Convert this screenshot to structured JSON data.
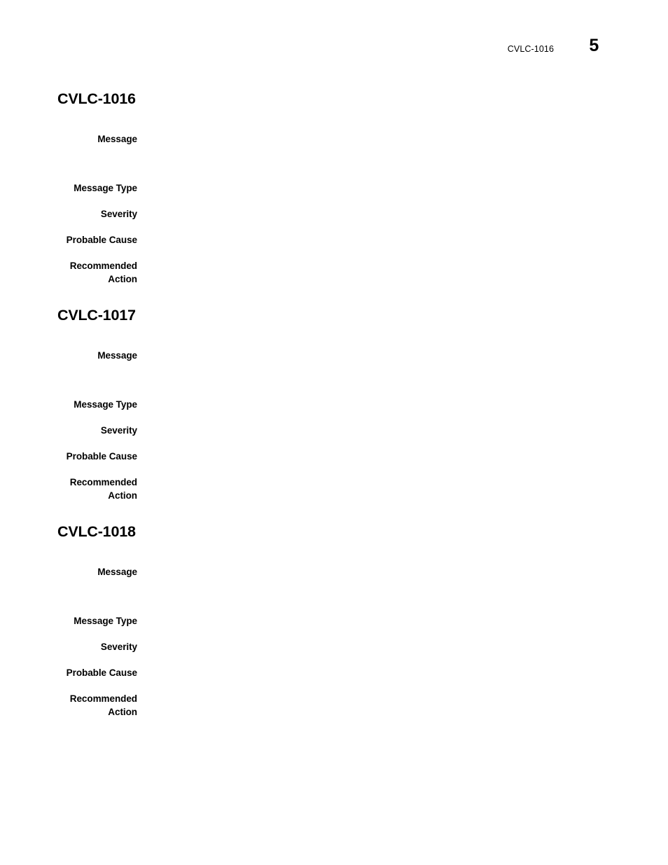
{
  "page": {
    "running_head": "CVLC-1016",
    "page_number": "5",
    "background_color": "#ffffff",
    "text_color": "#000000"
  },
  "labels": {
    "message": "Message",
    "message_type": "Message Type",
    "severity": "Severity",
    "probable_cause": "Probable Cause",
    "recommended_action": "Recommended\nAction"
  },
  "sections": [
    {
      "heading": "CVLC-1016",
      "message": "",
      "message_type": "",
      "severity": "",
      "probable_cause": "",
      "recommended_action": ""
    },
    {
      "heading": "CVLC-1017",
      "message": "",
      "message_type": "",
      "severity": "",
      "probable_cause": "",
      "recommended_action": ""
    },
    {
      "heading": "CVLC-1018",
      "message": "",
      "message_type": "",
      "severity": "",
      "probable_cause": "",
      "recommended_action": ""
    }
  ]
}
